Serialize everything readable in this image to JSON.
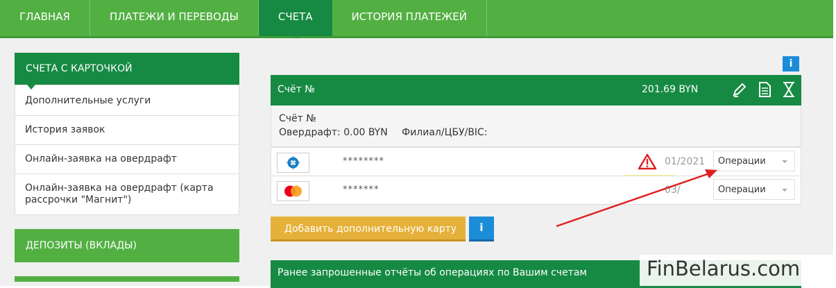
{
  "nav": {
    "tabs": [
      {
        "label": "ГЛАВНАЯ"
      },
      {
        "label": "ПЛАТЕЖИ И ПЕРЕВОДЫ"
      },
      {
        "label": "СЧЕТА"
      },
      {
        "label": "ИСТОРИЯ ПЛАТЕЖЕЙ"
      }
    ]
  },
  "sidebar": {
    "heading": "СЧЕТА С КАРТОЧКОЙ",
    "items": [
      {
        "label": "Дополнительные услуги"
      },
      {
        "label": "История заявок"
      },
      {
        "label": "Онлайн-заявка на овердрафт"
      },
      {
        "label": "Онлайн-заявка на овердрафт (карта рассрочки \"Магнит\")"
      }
    ],
    "deposits": "ДЕПОЗИТЫ (ВКЛАДЫ)"
  },
  "info_label": "i",
  "account": {
    "header_title": "Счёт №",
    "balance": "201.69 BYN",
    "body_line1": "Счёт №",
    "overdraft": "Овердрафт: 0.00 BYN",
    "branch": "Филиал/ЦБУ/BIC:",
    "icons": [
      "edit-icon",
      "document-icon",
      "hourglass-icon"
    ]
  },
  "cards": [
    {
      "logo": "belcard-logo",
      "number": "********",
      "expiry": "01/2021",
      "operations": "Операции",
      "warning": true
    },
    {
      "logo": "mastercard-logo",
      "number": "*******",
      "expiry": "03/",
      "operations": "Операции",
      "warning": false
    }
  ],
  "add_card_label": "Добавить дополнительную карту",
  "reports_title": "Ранее запрошенные отчёты об операциях по Вашим счетам",
  "watermark": "FinBelarus.com",
  "colors": {
    "primary_green": "#168a43",
    "light_green": "#52b043",
    "accent_orange": "#e6b13a",
    "info_blue": "#1b8cd8",
    "annotation_red": "#e02020"
  }
}
